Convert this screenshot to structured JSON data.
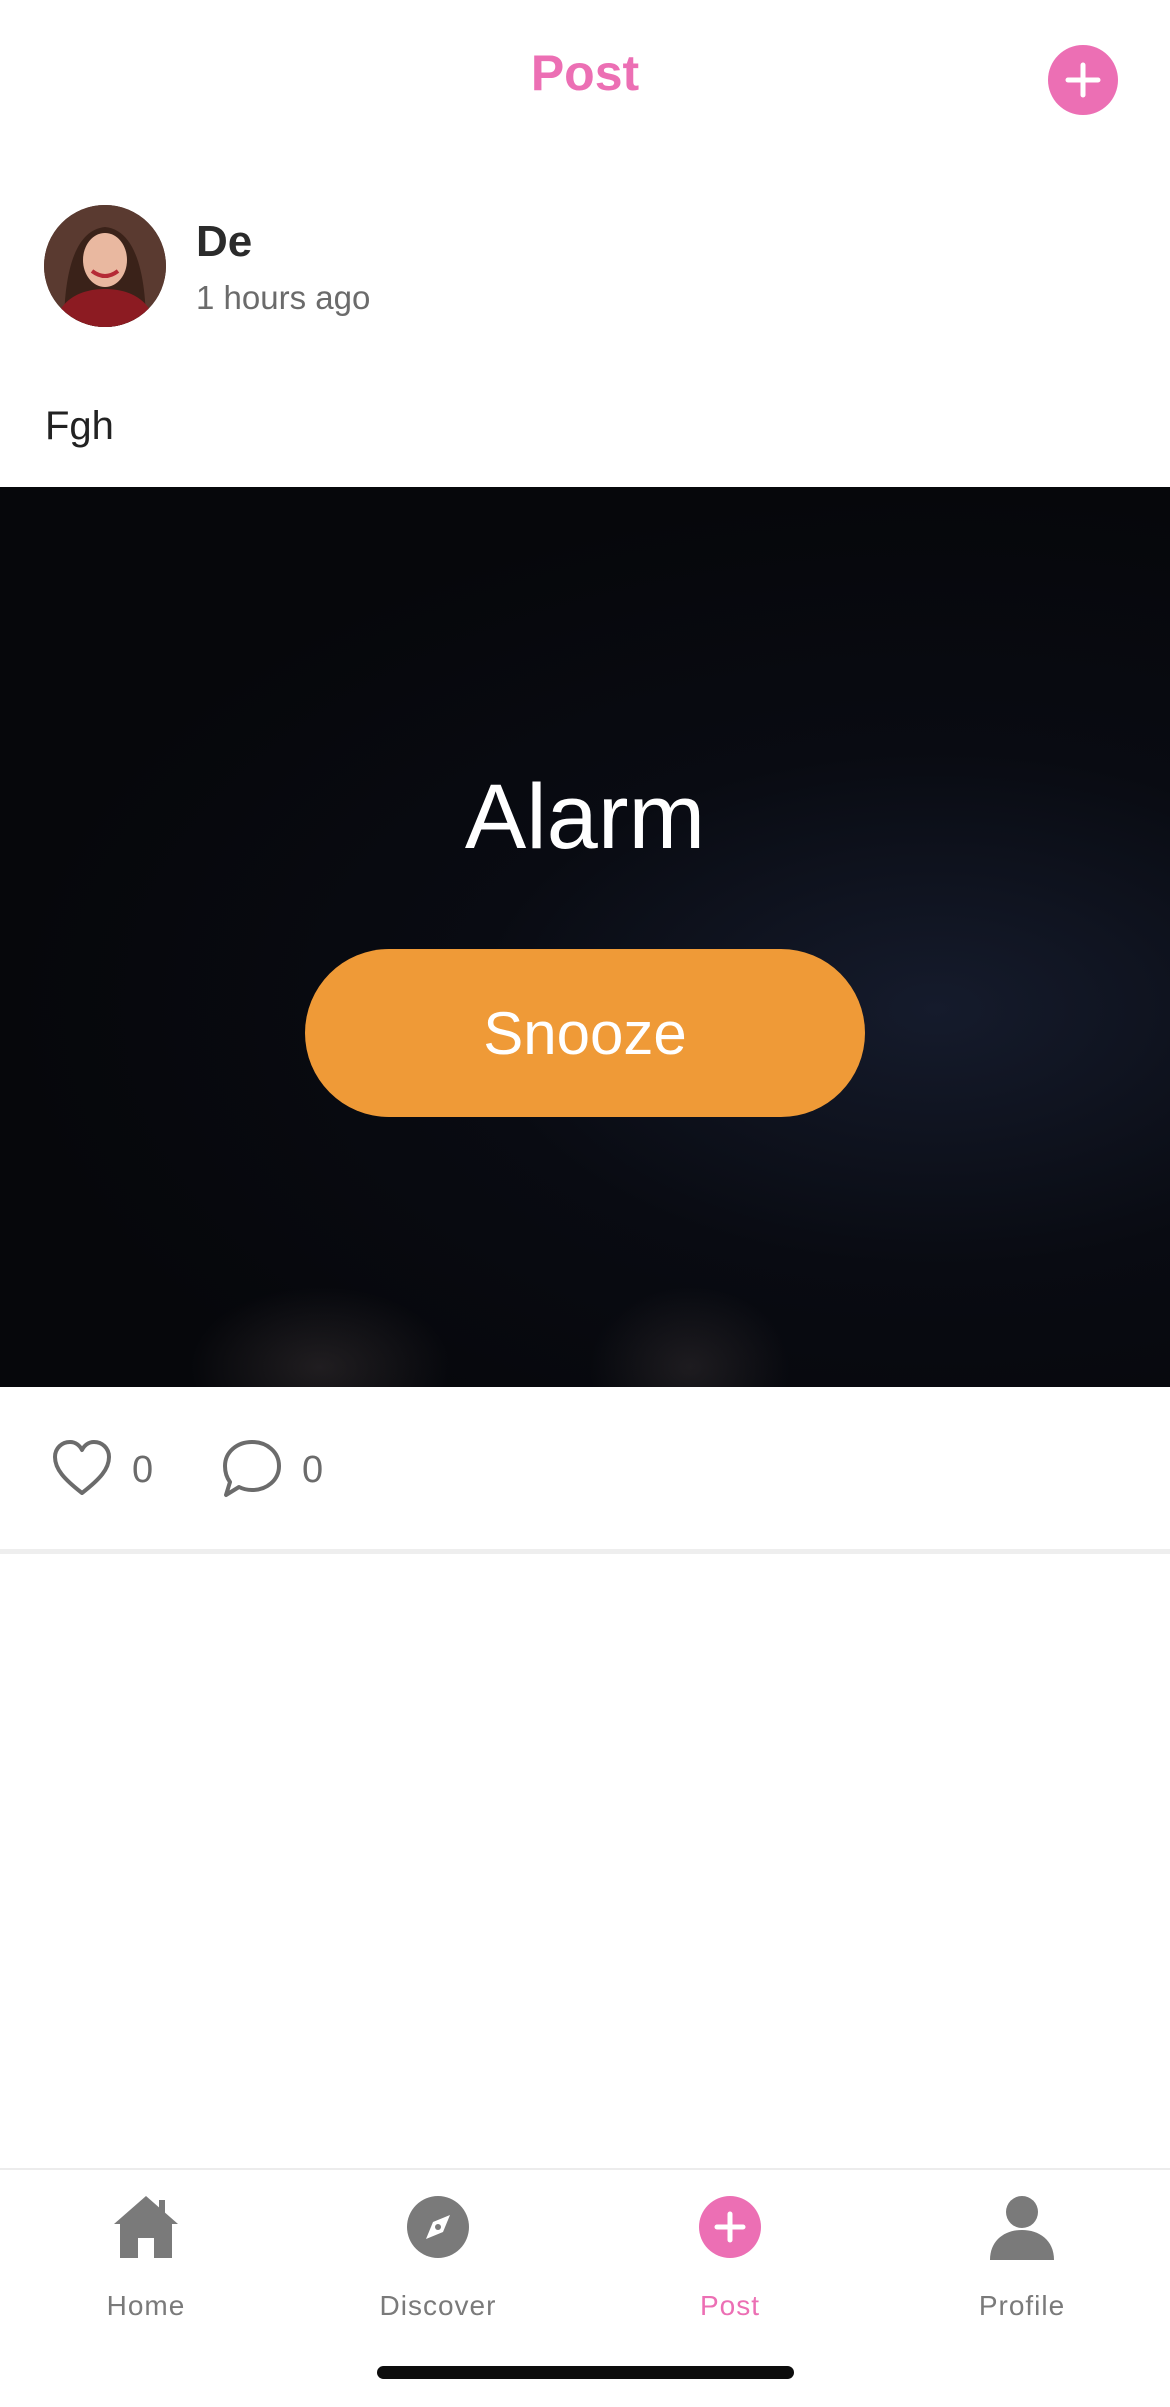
{
  "header": {
    "title": "Post",
    "add_icon": "plus-circle-icon"
  },
  "post": {
    "author": {
      "name": "De",
      "time": "1 hours ago",
      "avatar_icon": "avatar-photo"
    },
    "text": "Fgh",
    "media": {
      "title": "Alarm",
      "button_label": "Snooze"
    },
    "actions": {
      "likes": {
        "icon": "heart-icon",
        "count": "0"
      },
      "comments": {
        "icon": "comment-bubble-icon",
        "count": "0"
      }
    }
  },
  "tabbar": {
    "items": [
      {
        "label": "Home",
        "icon": "home-icon",
        "active": false
      },
      {
        "label": "Discover",
        "icon": "compass-icon",
        "active": false
      },
      {
        "label": "Post",
        "icon": "plus-circle-icon",
        "active": true
      },
      {
        "label": "Profile",
        "icon": "person-icon",
        "active": false
      }
    ]
  },
  "colors": {
    "accent": "#ec6fb4",
    "snooze_button": "#ef9a37",
    "tab_inactive": "#7a7a7a",
    "media_background": "#06070b"
  }
}
